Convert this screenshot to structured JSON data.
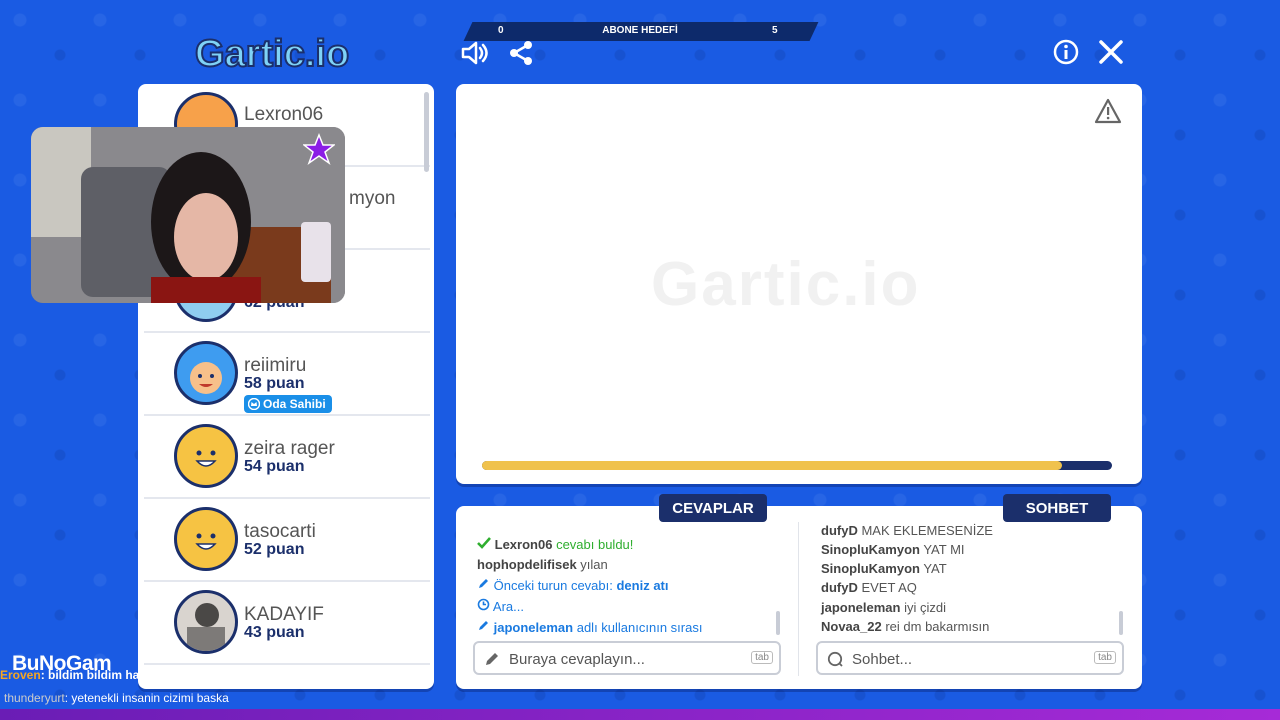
{
  "app": {
    "logo_text": "Gartic.io",
    "goal": {
      "title": "ABONE HEDEFİ",
      "current": "0",
      "target": "5"
    }
  },
  "header_icons": [
    "speaker-icon",
    "share-icon",
    "info-icon",
    "close-icon"
  ],
  "players": [
    {
      "name": "Lexron06",
      "score": ""
    },
    {
      "name": "myon",
      "score": ""
    },
    {
      "name": "",
      "score": "62 puan"
    },
    {
      "name": "reiimiru",
      "score": "58 puan",
      "badge": "Oda Sahibi"
    },
    {
      "name": "zeira rager",
      "score": "54 puan"
    },
    {
      "name": "tasocarti",
      "score": "52 puan"
    },
    {
      "name": "KADAYIF",
      "score": "43 puan"
    }
  ],
  "canvas": {
    "watermark": "Gartic.io",
    "progress": 0.92
  },
  "answers": {
    "title": "CEVAPLAR",
    "lines": [
      {
        "user": "Lexron06",
        "text": "cevabı buldu!",
        "kind": "found"
      },
      {
        "user": "hophopdelifisek",
        "text": "yılan",
        "kind": "msg"
      },
      {
        "user": "",
        "text": "Önceki turun cevabı:",
        "extra": "deniz atı",
        "kind": "prev"
      },
      {
        "user": "",
        "text": "Ara...",
        "kind": "wait"
      },
      {
        "user": "japoneleman",
        "text": "adlı kullanıcının sırası",
        "kind": "turn"
      }
    ],
    "placeholder": "Buraya cevaplayın...",
    "tab_hint": "tab"
  },
  "chat": {
    "title": "SOHBET",
    "lines": [
      {
        "user": "dufyD",
        "text": "MAK EKLEMESENİZE"
      },
      {
        "user": "SinopluKamyon",
        "text": "YAT MI"
      },
      {
        "user": "SinopluKamyon",
        "text": "YAT"
      },
      {
        "user": "dufyD",
        "text": "EVET AQ"
      },
      {
        "user": "japoneleman",
        "text": "iyi çizdi"
      },
      {
        "user": "Novaa_22",
        "text": "rei dm bakarmısın"
      }
    ],
    "placeholder": "Sohbet...",
    "tab_hint": "tab"
  },
  "overlay": {
    "brand": "BuNoGam",
    "ticker1_user": "Eroven",
    "ticker1_text": ": bildim bildim haberim var bizde deriniz ama yetişedim kral :D",
    "ticker2_user": "thunderyurt",
    "ticker2_text": ": yetenekli insanin cizimi baska"
  },
  "colors": {
    "background": "#1a5be3",
    "navy": "#1b2f6b",
    "progress": "#f0c24d",
    "badge": "#1a8fe8"
  }
}
